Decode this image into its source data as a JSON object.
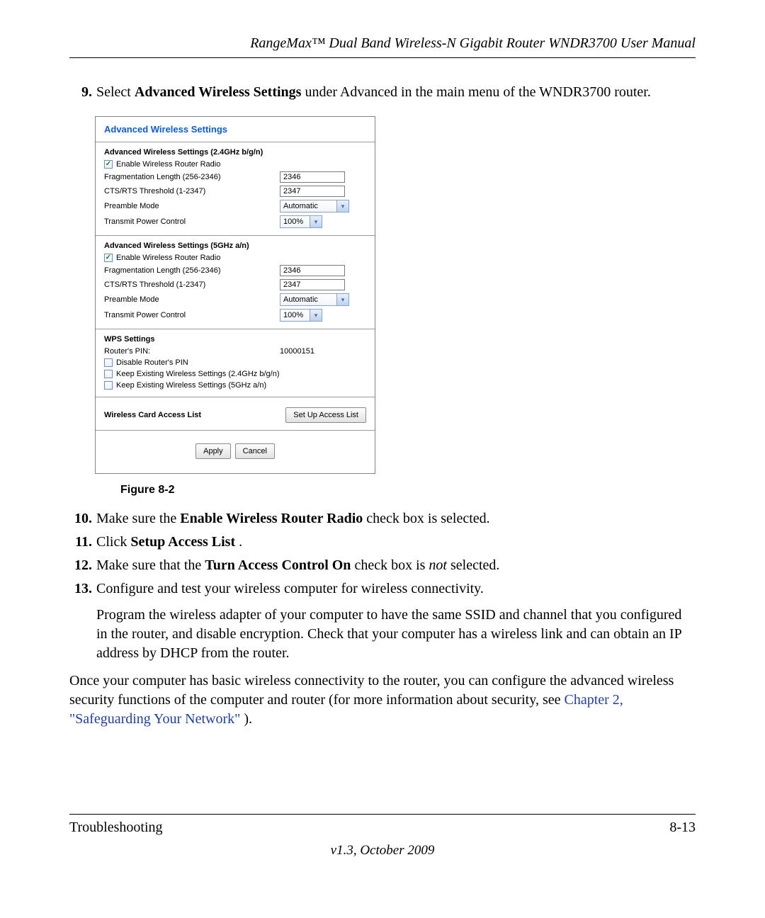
{
  "header": {
    "title": "RangeMax™ Dual Band Wireless-N Gigabit Router WNDR3700 User Manual"
  },
  "steps": {
    "item9": {
      "num": "9.",
      "pre": "Select ",
      "b1": "Advanced Wireless Settings",
      "post": " under Advanced in the main menu of the WNDR3700 router."
    },
    "item10": {
      "num": "10.",
      "pre": "Make sure the ",
      "b1": "Enable Wireless Router Radio",
      "post": " check box is selected."
    },
    "item11": {
      "num": "11.",
      "pre": "Click ",
      "b1": "Setup Access List",
      "post": "."
    },
    "item12": {
      "num": "12.",
      "pre": "Make sure that the ",
      "b1": "Turn Access Control On",
      "mid": " check box is ",
      "i1": "not",
      "post": " selected."
    },
    "item13": {
      "num": "13.",
      "line1": "Configure and test your wireless computer for wireless connectivity.",
      "line2": "Program the wireless adapter of your computer to have the same SSID and channel that you configured in the router, and disable encryption. Check that your computer has a wireless link and can obtain an IP address by DHCP from the router."
    }
  },
  "afterpara": {
    "t1": "Once your computer has basic wireless connectivity to the router, you can configure the advanced wireless security functions of the computer and router (for more information about security, see ",
    "link": "Chapter 2, \"Safeguarding Your Network\"",
    "t2": ")."
  },
  "figure": {
    "caption": "Figure 8-2"
  },
  "shot": {
    "title": "Advanced Wireless Settings",
    "g24": {
      "heading": "Advanced Wireless Settings (2.4GHz b/g/n)",
      "enable": "Enable Wireless Router Radio",
      "frag_label": "Fragmentation Length (256-2346)",
      "frag_val": "2346",
      "cts_label": "CTS/RTS Threshold (1-2347)",
      "cts_val": "2347",
      "preamble_label": "Preamble Mode",
      "preamble_val": "Automatic",
      "txpower_label": "Transmit Power Control",
      "txpower_val": "100%"
    },
    "g5": {
      "heading": "Advanced Wireless Settings (5GHz a/n)",
      "enable": "Enable Wireless Router Radio",
      "frag_label": "Fragmentation Length (256-2346)",
      "frag_val": "2346",
      "cts_label": "CTS/RTS Threshold (1-2347)",
      "cts_val": "2347",
      "preamble_label": "Preamble Mode",
      "preamble_val": "Automatic",
      "txpower_label": "Transmit Power Control",
      "txpower_val": "100%"
    },
    "wps": {
      "heading": "WPS Settings",
      "pin_label": "Router's PIN:",
      "pin_val": "10000151",
      "disable_pin": "Disable Router's PIN",
      "keep24": "Keep Existing Wireless Settings (2.4GHz b/g/n)",
      "keep5": "Keep Existing Wireless Settings (5GHz a/n)"
    },
    "access": {
      "label": "Wireless Card Access List",
      "button": "Set Up Access List"
    },
    "buttons": {
      "apply": "Apply",
      "cancel": "Cancel"
    }
  },
  "footer": {
    "section": "Troubleshooting",
    "page": "8-13",
    "version": "v1.3, October 2009"
  }
}
